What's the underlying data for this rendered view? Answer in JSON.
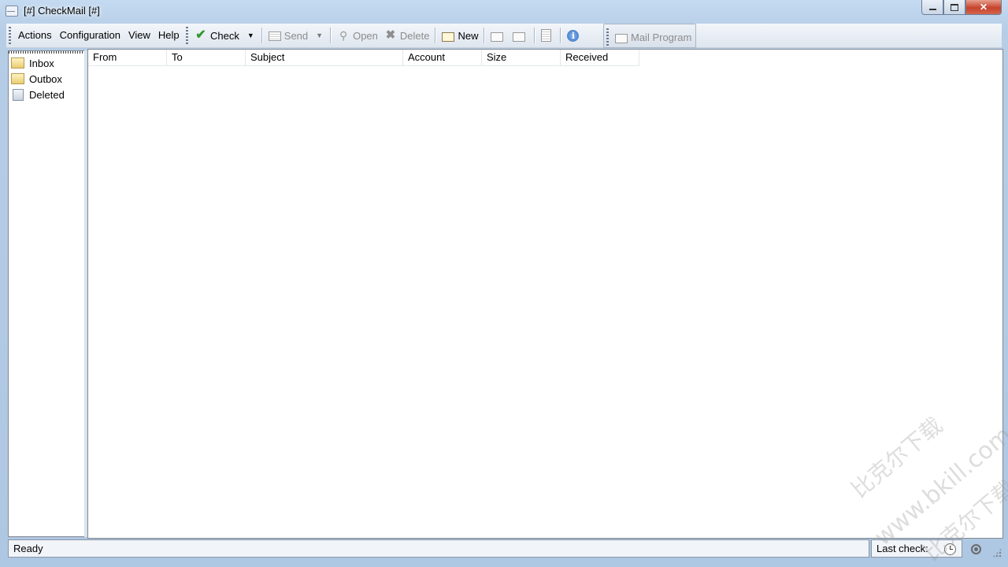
{
  "window": {
    "title": "[#] CheckMail [#]"
  },
  "menu": {
    "items": [
      "Actions",
      "Configuration",
      "View",
      "Help"
    ]
  },
  "toolbar": {
    "check_label": "Check",
    "send_label": "Send",
    "open_label": "Open",
    "delete_label": "Delete",
    "new_label": "New",
    "mail_program_label": "Mail Program",
    "dropdown_arrow": "▼"
  },
  "folders": [
    {
      "label": "Inbox",
      "icon": "inbox-folder-icon"
    },
    {
      "label": "Outbox",
      "icon": "outbox-folder-icon"
    },
    {
      "label": "Deleted",
      "icon": "deleted-folder-icon"
    }
  ],
  "message_list": {
    "columns": [
      "From",
      "To",
      "Subject",
      "Account",
      "Size",
      "Received"
    ],
    "rows": []
  },
  "statusbar": {
    "status_text": "Ready",
    "last_check_label": "Last check:"
  },
  "watermark": {
    "line1": "比克尔下载",
    "line2": "www.bkill.com",
    "line3": "比克尔下载"
  },
  "colors": {
    "window_frame": "#b9d1ea",
    "check_icon": "#2f9a2f",
    "info_icon": "#2f6bc1"
  }
}
